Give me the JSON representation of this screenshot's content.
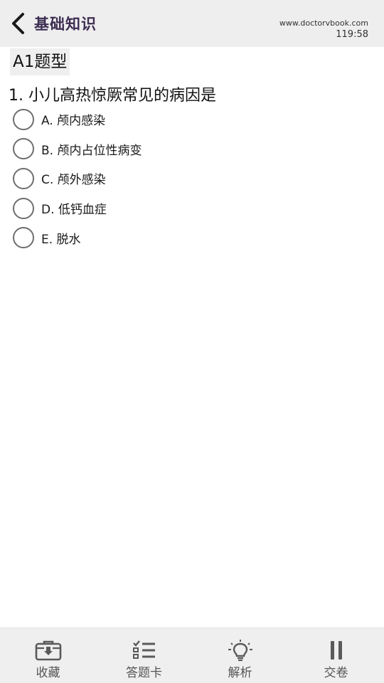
{
  "header": {
    "title": "基础知识",
    "site": "www.doctorvbook.com",
    "timer": "119:58"
  },
  "question_type": "A1题型",
  "question": {
    "text": "1. 小儿高热惊厥常见的病因是",
    "options": [
      {
        "label": "A. 颅内感染"
      },
      {
        "label": "B. 颅内占位性病变"
      },
      {
        "label": "C. 颅外感染"
      },
      {
        "label": "D. 低钙血症"
      },
      {
        "label": "E. 脱水"
      }
    ]
  },
  "footer": {
    "tabs": [
      {
        "label": "收藏",
        "icon": "briefcase-download-icon"
      },
      {
        "label": "答题卡",
        "icon": "checklist-icon"
      },
      {
        "label": "解析",
        "icon": "lightbulb-icon"
      },
      {
        "label": "交卷",
        "icon": "pause-icon"
      }
    ]
  },
  "colors": {
    "header_bg": "#efeeef",
    "title": "#3d2e52",
    "footer_bg": "#efefef",
    "icon": "#5a5a5a"
  }
}
